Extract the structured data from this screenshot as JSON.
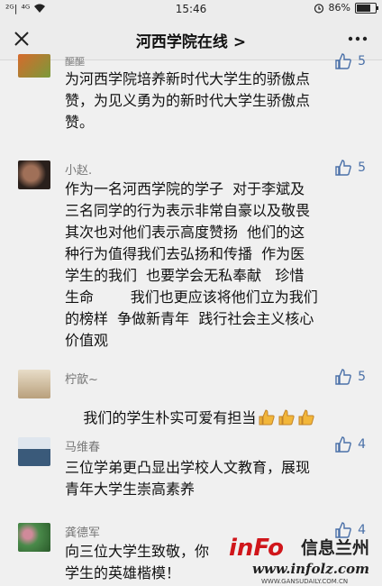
{
  "status_bar": {
    "left_text": "²ᴳ|",
    "carrier": "⁴ᴳ",
    "time": "15:46",
    "battery_text": "86%",
    "battery_level": 0.86
  },
  "nav": {
    "title": "河西学院在线 >",
    "close_icon": "close-icon",
    "more_icon": "more-icon"
  },
  "comments": [
    {
      "name": "醧醧",
      "likes": "5",
      "text": "为河西学院培养新时代大学生的骄傲点\n赞，为见义勇为的新时代大学生骄傲点\n赞。",
      "avatar_color": "#c85a2a"
    },
    {
      "name": "小赵.",
      "likes": "5",
      "text": "作为一名河西学院的学子  对于李斌及\n三名同学的行为表示非常自豪以及敬畏\n其次也对他们表示高度赞扬  他们的这\n种行为值得我们去弘扬和传播  作为医\n学生的我们  也要学会无私奉献   珍惜\n生命        我们也更应该将他们立为我们\n的榜样  争做新青年  践行社会主义核心\n价值观",
      "avatar_color": "#3a2a26"
    },
    {
      "name": "柠歆~",
      "likes": "5",
      "text": "我们的学生朴实可爱有担当",
      "avatar_color": "#c8b79a"
    },
    {
      "name": "马维春",
      "likes": "4",
      "text": "三位学弟更凸显出学校人文教育，展现\n青年大学生崇高素养",
      "avatar_color": "#8aa0b8"
    },
    {
      "name": "龚德军",
      "likes": "4",
      "text": "向三位大学生致敬，你\n学生的英雄楷模！",
      "avatar_color": "#4a8a4a"
    }
  ],
  "watermark": {
    "brand": "inFo",
    "cn": "信息兰州",
    "site": "www.infolz.com",
    "sub": "WWW.GANSUDAILY.COM.CN"
  }
}
